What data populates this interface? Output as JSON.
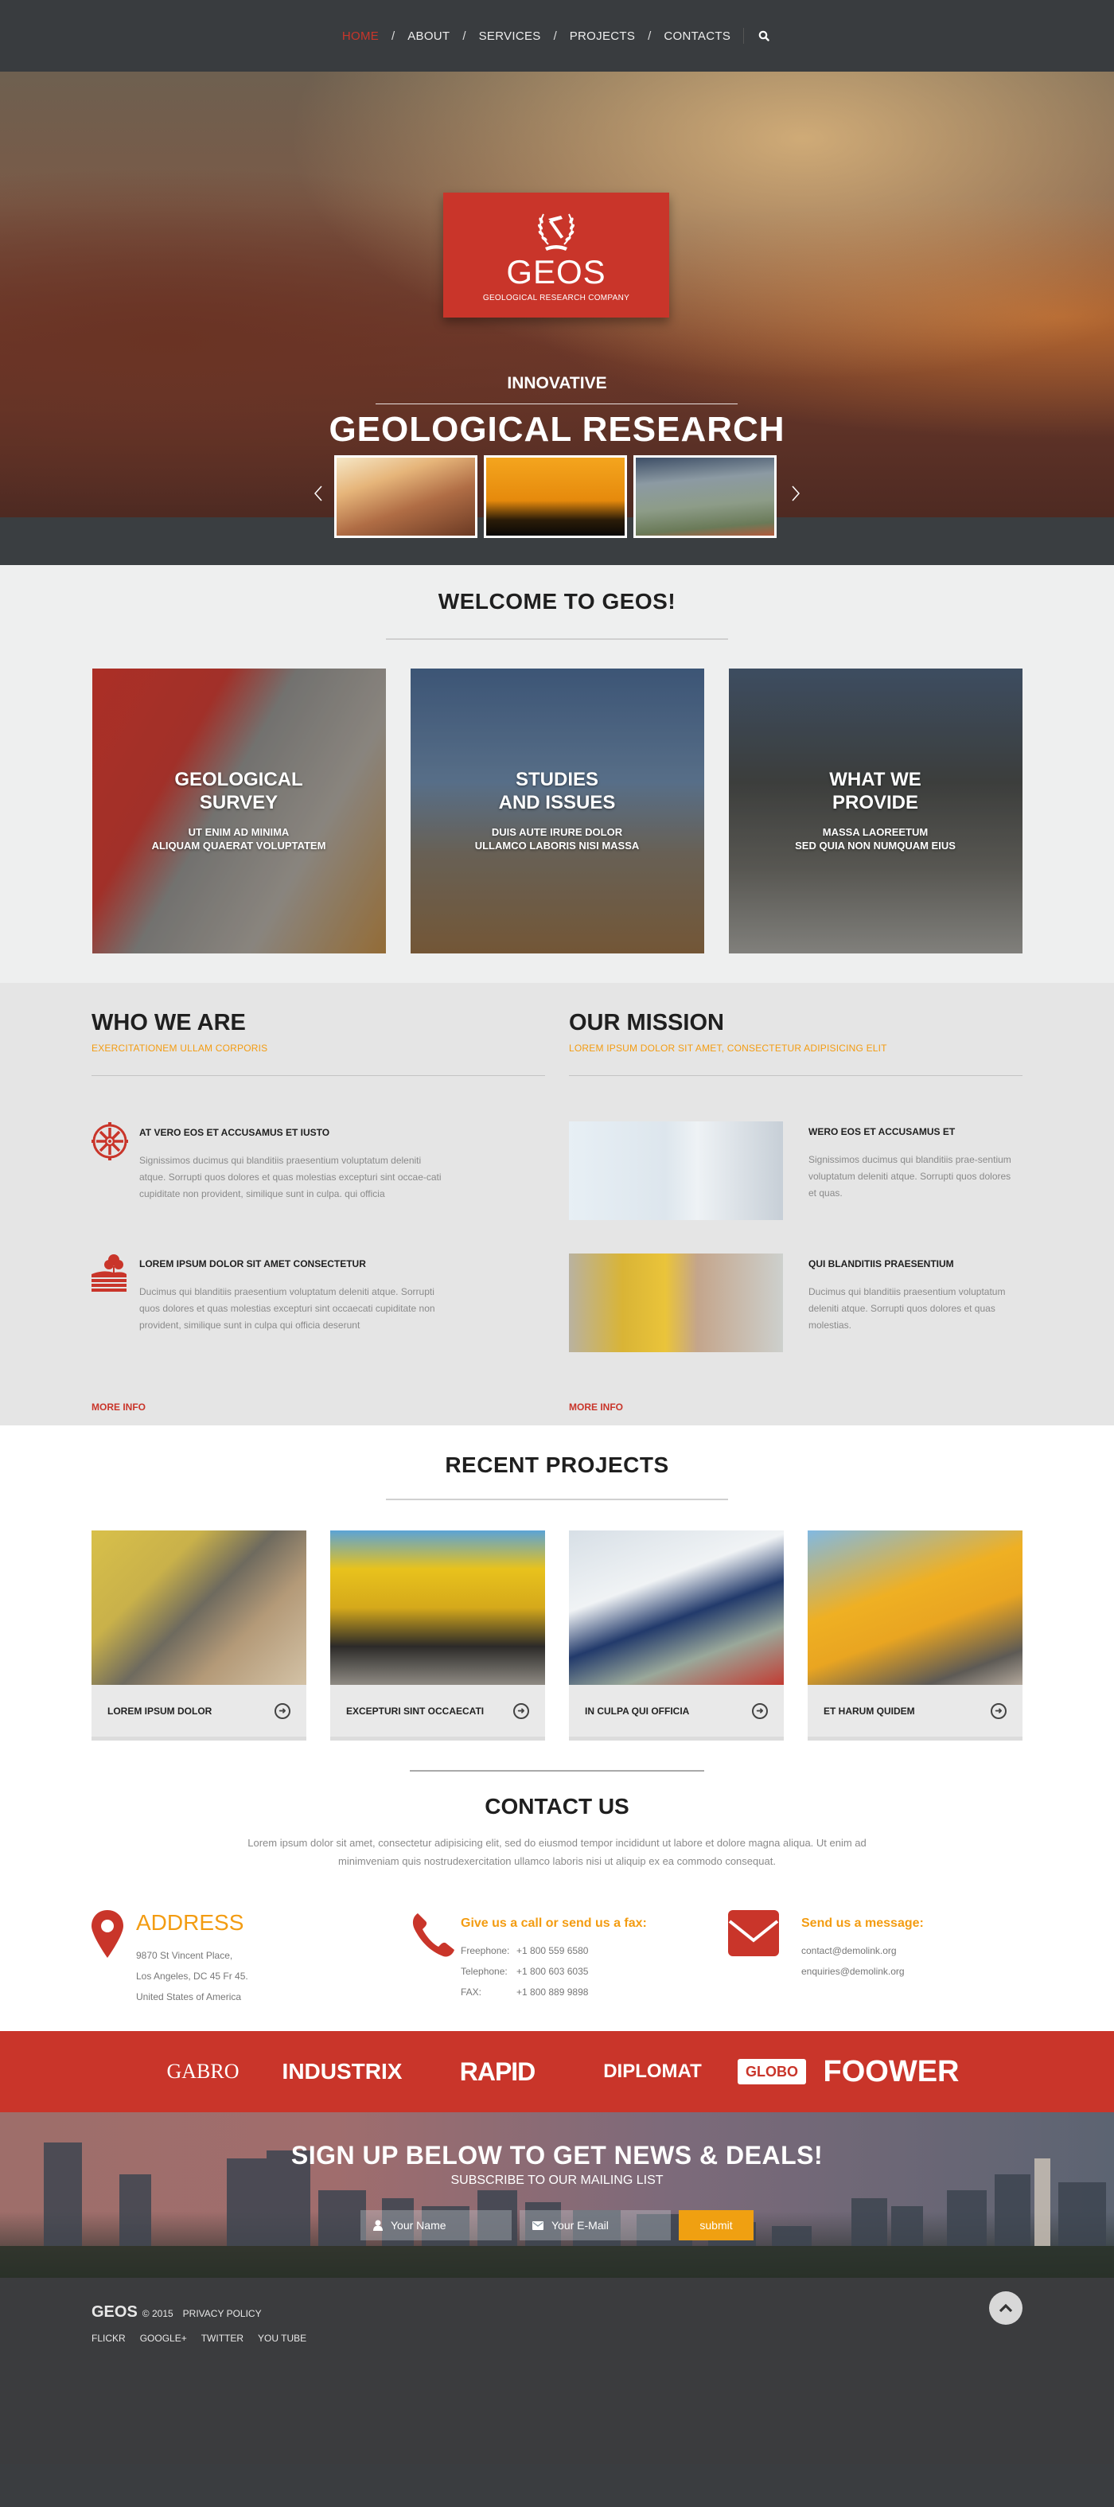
{
  "nav": {
    "items": [
      {
        "label": "HOME",
        "active": true
      },
      {
        "label": "ABOUT",
        "active": false
      },
      {
        "label": "SERVICES",
        "active": false
      },
      {
        "label": "PROJECTS",
        "active": false
      },
      {
        "label": "CONTACTS",
        "active": false
      }
    ],
    "separator": "/",
    "search_icon": "search-icon"
  },
  "hero": {
    "logo": {
      "name": "GEOS",
      "tagline": "GEOLOGICAL RESEARCH COMPANY",
      "emblem_icon": "pickaxe-laurel-icon"
    },
    "kicker": "INNOVATIVE",
    "title": "GEOLOGICAL RESEARCH",
    "slider": {
      "prev_icon": "chevron-left-icon",
      "next_icon": "chevron-right-icon",
      "thumbnails": [
        "canyon-sunrise",
        "oil-rig-sunset-silhouette",
        "canyon-overlook"
      ]
    }
  },
  "welcome": {
    "title": "WELCOME TO GEOS!",
    "cards": [
      {
        "title": "GEOLOGICAL\nSURVEY",
        "subtitle": "UT ENIM AD MINIMA\nALIQUAM QUAERAT VOLUPTATEM"
      },
      {
        "title": "STUDIES\nAND ISSUES",
        "subtitle": "DUIS AUTE IRURE DOLOR\nULLAMCO LABORIS NISI MASSA"
      },
      {
        "title": "WHAT WE\nPROVIDE",
        "subtitle": "MASSA LAOREETUM\nSED QUIA NON NUMQUAM EIUS"
      }
    ]
  },
  "who_we_are": {
    "title": "WHO WE ARE",
    "subtitle": "EXERCITATIONEM ULLAM CORPORIS",
    "features": [
      {
        "icon": "gear-wheel-icon",
        "title": "AT VERO EOS ET ACCUSAMUS ET IUSTO",
        "text": "Signissimos ducimus qui blanditiis praesentium voluptatum deleniti atque. Sorrupti quos dolores et quas molestias excepturi sint occae-cati cupiditate non provident, similique sunt in culpa. qui officia"
      },
      {
        "icon": "tree-terrain-icon",
        "title": "LOREM IPSUM DOLOR SIT AMET CONSECTETUR",
        "text": "Ducimus qui blanditiis praesentium voluptatum deleniti atque. Sorrupti quos dolores et quas molestias excepturi sint occaecati cupiditate non provident, similique sunt in culpa qui officia deserunt"
      }
    ],
    "more_label": "MORE INFO"
  },
  "our_mission": {
    "title": "OUR MISSION",
    "subtitle": "LOREM IPSUM DOLOR SIT AMET, CONSECTETUR ADIPISICING ELIT",
    "features": [
      {
        "image": "engineer-white-hardhat",
        "title": "WERO EOS ET ACCUSAMUS ET",
        "text": "Signissimos ducimus qui blanditiis prae-sentium voluptatum deleniti atque. Sorrupti quos dolores et quas."
      },
      {
        "image": "worker-yellow-hardhat",
        "title": "QUI BLANDITIIS PRAESENTIUM",
        "text": "Ducimus qui blanditiis praesentium voluptatum deleniti atque. Sorrupti quos dolores et quas molestias."
      }
    ],
    "more_label": "MORE INFO"
  },
  "projects": {
    "title": "RECENT PROJECTS",
    "items": [
      {
        "title": "LOREM IPSUM DOLOR",
        "image": "bulldozer"
      },
      {
        "title": "EXCEPTURI SINT OCCAECATI",
        "image": "mining-truck"
      },
      {
        "title": "IN CULPA QUI OFFICIA",
        "image": "surveyor-theodolite"
      },
      {
        "title": "ET HARUM QUIDEM",
        "image": "excavator-loading-truck"
      }
    ],
    "arrow_icon": "arrow-right-circle-icon"
  },
  "contact": {
    "title": "CONTACT US",
    "intro": "Lorem ipsum dolor sit amet, consectetur adipisicing elit, sed do eiusmod tempor incididunt ut labore et dolore magna aliqua. Ut enim ad minimveniam quis nostrudexercitation ullamco laboris nisi ut aliquip ex ea commodo consequat.",
    "address": {
      "heading": "ADDRESS",
      "lines": [
        "9870 St Vincent Place,",
        "Los Angeles, DC 45 Fr 45.",
        "United States of America"
      ]
    },
    "phone": {
      "heading": "Give us a call or send us a fax:",
      "lines": [
        {
          "label": "Freephone:",
          "value": "+1 800 559 6580"
        },
        {
          "label": "Telephone:",
          "value": "+1 800 603 6035"
        },
        {
          "label": "FAX:",
          "value": "+1 800 889 9898"
        }
      ]
    },
    "email": {
      "heading": "Send us a message:",
      "lines": [
        "contact@demolink.org",
        "enquiries@demolink.org"
      ]
    }
  },
  "partners": [
    "GABRO",
    "INDUSTRIX",
    "RAPID",
    "DIPLOMAT",
    "GLOBO",
    "FOOWER"
  ],
  "newsletter": {
    "title": "SIGN UP BELOW TO GET NEWS & DEALS!",
    "subtitle": "SUBSCRIBE TO OUR MAILING LIST",
    "name_placeholder": "Your Name",
    "email_placeholder": "Your E-Mail",
    "submit_label": "submit"
  },
  "footer": {
    "brand": "GEOS",
    "copyright": "© 2015",
    "privacy": "PRIVACY POLICY",
    "links": [
      "FLICKR",
      "GOOGLE+",
      "TWITTER",
      "YOU TUBE"
    ],
    "to_top_icon": "chevron-up-icon"
  },
  "colors": {
    "accent_red": "#c9352a",
    "accent_orange": "#f39c12",
    "dark": "#3a3d40"
  }
}
